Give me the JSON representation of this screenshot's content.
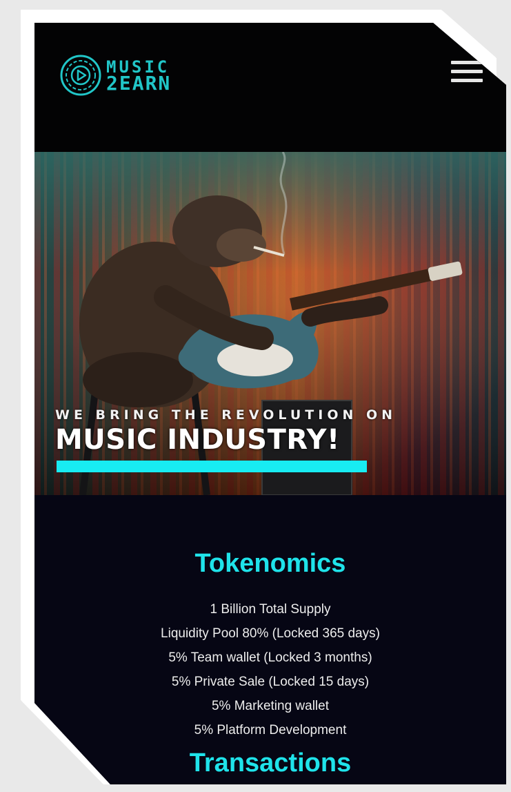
{
  "brand": {
    "line1": "MUSIC",
    "line2": "2EARN",
    "color": "#21c6c8",
    "icon": "play-disc-icon"
  },
  "header": {
    "menu_icon": "hamburger-menu-icon"
  },
  "hero": {
    "subtitle": "WE BRING THE REVOLUTION ON",
    "title": "MUSIC INDUSTRY!",
    "accent": "#18ecf2"
  },
  "tokenomics": {
    "title": "Tokenomics",
    "items": [
      "1 Billion Total Supply",
      "Liquidity Pool 80% (Locked 365 days)",
      "5% Team wallet (Locked 3 months)",
      "5% Private Sale (Locked 15 days)",
      "5% Marketing wallet",
      "5% Platform Development"
    ]
  },
  "transactions": {
    "title": "Transactions"
  },
  "colors": {
    "background": "#05050f",
    "heading": "#1fe3ea",
    "text": "#ededed"
  }
}
